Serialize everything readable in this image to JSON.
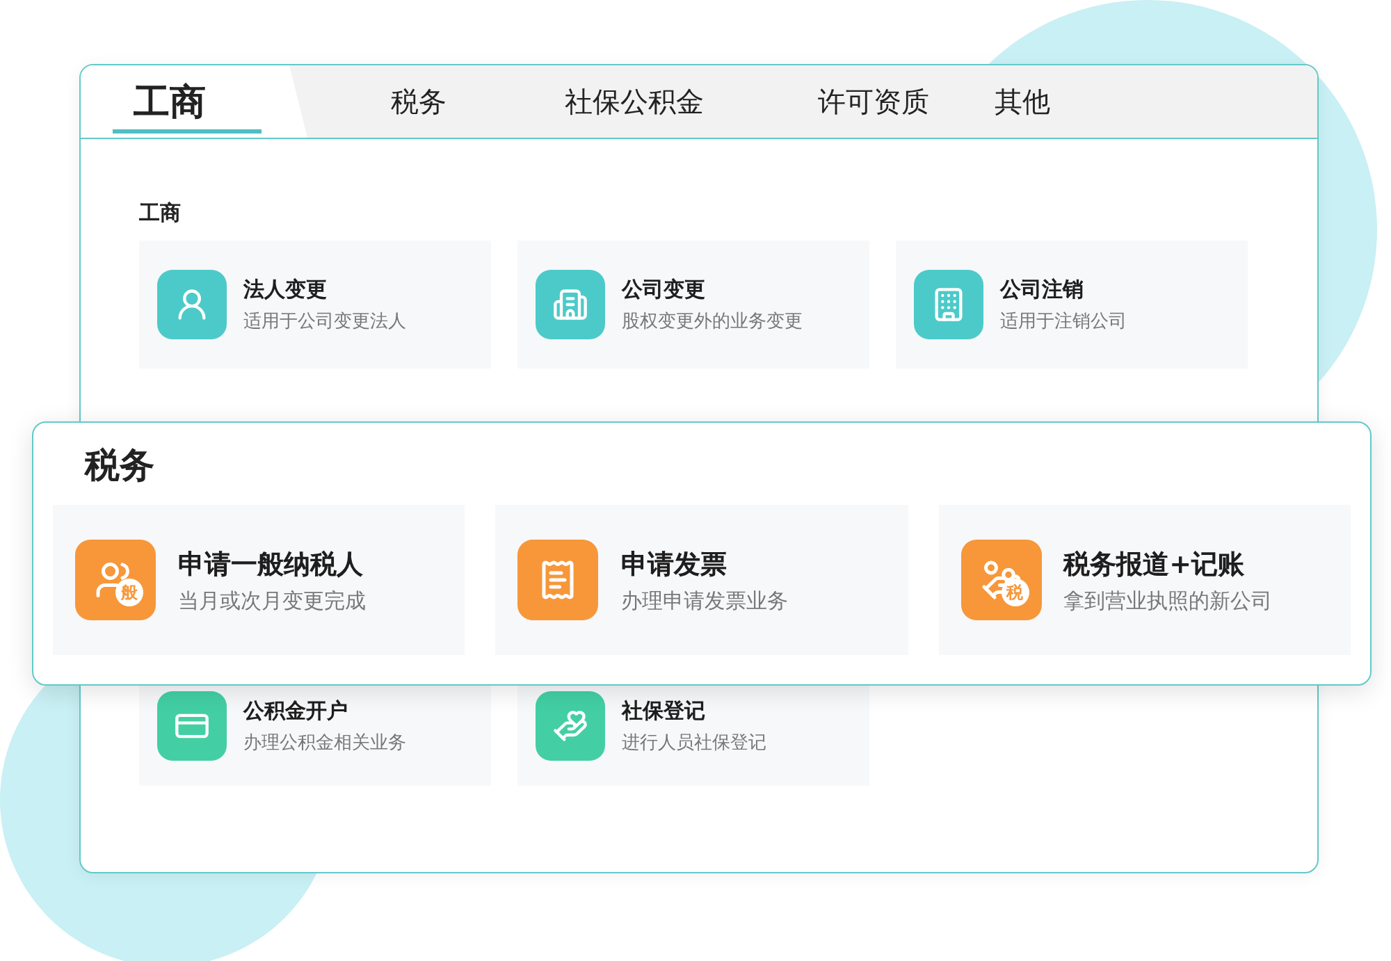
{
  "tabs": [
    {
      "label": "工商",
      "selected": true
    },
    {
      "label": "税务",
      "selected": false
    },
    {
      "label": "社保公积金",
      "selected": false
    },
    {
      "label": "许可资质",
      "selected": false
    },
    {
      "label": "其他",
      "selected": false
    }
  ],
  "sections": [
    {
      "kind": "business",
      "heading": "工商",
      "items": [
        {
          "title": "法人变更",
          "subtitle": "适用于公司变更法人"
        },
        {
          "title": "公司变更",
          "subtitle": "股权变更外的业务变更"
        },
        {
          "title": "公司注销",
          "subtitle": "适用于注销公司"
        }
      ]
    },
    {
      "kind": "social",
      "items": [
        {
          "title": "公积金开户",
          "subtitle": "办理公积金相关业务"
        },
        {
          "title": "社保登记",
          "subtitle": "进行人员社保登记"
        }
      ]
    }
  ],
  "popout": {
    "kind": "tax",
    "heading": "税务",
    "items": [
      {
        "title": "申请一般纳税人",
        "subtitle": "当月或次月变更完成",
        "badge": "般"
      },
      {
        "title": "申请发票",
        "subtitle": "办理申请发票业务"
      },
      {
        "title": "税务报道+记账",
        "subtitle": "拿到营业执照的新公司",
        "badge": "税"
      }
    ]
  }
}
